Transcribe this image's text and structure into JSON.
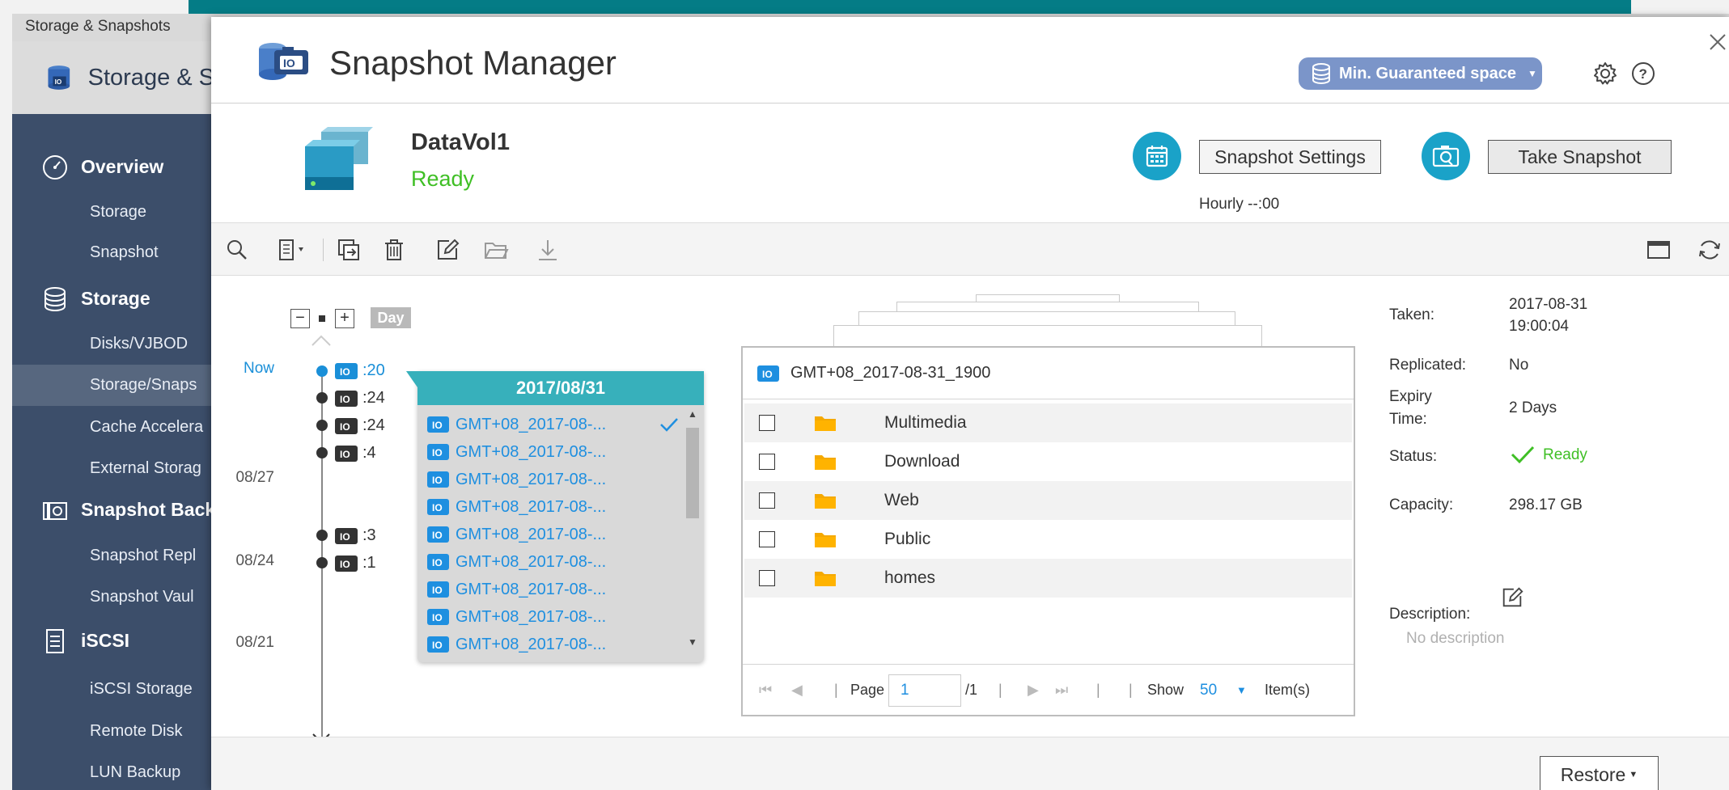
{
  "background_app": {
    "window_title": "Storage & Snapshots",
    "app_title": "Storage & S",
    "sidebar": [
      {
        "label": "Overview",
        "type": "section",
        "icon": "dashboard-icon"
      },
      {
        "label": "Storage",
        "type": "sub"
      },
      {
        "label": "Snapshot",
        "type": "sub"
      },
      {
        "label": "Storage",
        "type": "section",
        "icon": "database-icon"
      },
      {
        "label": "Disks/VJBOD",
        "type": "sub"
      },
      {
        "label": "Storage/Snaps",
        "type": "sub",
        "selected": true
      },
      {
        "label": "Cache Accelera",
        "type": "sub"
      },
      {
        "label": "External Storag",
        "type": "sub"
      },
      {
        "label": "Snapshot Back",
        "type": "section",
        "icon": "snapshot-icon"
      },
      {
        "label": "Snapshot Repl",
        "type": "sub"
      },
      {
        "label": "Snapshot Vaul",
        "type": "sub"
      },
      {
        "label": "iSCSI",
        "type": "section",
        "icon": "document-icon"
      },
      {
        "label": "iSCSI Storage",
        "type": "sub"
      },
      {
        "label": "Remote Disk",
        "type": "sub"
      },
      {
        "label": "LUN Backup",
        "type": "sub"
      }
    ]
  },
  "dialog": {
    "title": "Snapshot Manager",
    "space_button": "Min. Guaranteed space",
    "volume": {
      "name": "DataVol1",
      "status": "Ready"
    },
    "snapshot_settings_label": "Snapshot Settings",
    "schedule_text": "Hourly --:00",
    "take_snapshot_label": "Take Snapshot",
    "timeline": {
      "zoom_label": "Day",
      "date_labels": [
        "Now",
        "08/27",
        "08/24",
        "08/21"
      ],
      "snapshots": [
        ":20",
        ":24",
        ":24",
        ":4",
        ":3",
        ":1"
      ]
    },
    "snapshot_list": {
      "date": "2017/08/31",
      "items": [
        "GMT+08_2017-08-...",
        "GMT+08_2017-08-...",
        "GMT+08_2017-08-...",
        "GMT+08_2017-08-...",
        "GMT+08_2017-08-...",
        "GMT+08_2017-08-...",
        "GMT+08_2017-08-...",
        "GMT+08_2017-08-...",
        "GMT+08_2017-08-..."
      ]
    },
    "file_browser": {
      "snapshot_name": "GMT+08_2017-08-31_1900",
      "folders": [
        "Multimedia",
        "Download",
        "Web",
        "Public",
        "homes"
      ],
      "pager": {
        "page_label": "Page",
        "page_value": "1",
        "total_pages": "/1",
        "show_label": "Show",
        "show_value": "50",
        "items_label": "Item(s)"
      }
    },
    "info": {
      "taken_label": "Taken:",
      "taken_date": "2017-08-31",
      "taken_time": "19:00:04",
      "replicated_label": "Replicated:",
      "replicated_value": "No",
      "expiry_label_1": "Expiry",
      "expiry_label_2": "Time:",
      "expiry_value": "2 Days",
      "status_label": "Status:",
      "status_value": "Ready",
      "capacity_label": "Capacity:",
      "capacity_value": "298.17 GB",
      "description_label": "Description:",
      "description_value": "No description"
    },
    "restore_label": "Restore"
  },
  "colors": {
    "teal": "#047c86",
    "sidebar": "#3c4e6a",
    "accent_blue": "#1e8fe0",
    "ready_green": "#3fbf25",
    "list_header": "#37b0bb",
    "space_button": "#7b95c9",
    "folder": "#f5a900"
  }
}
